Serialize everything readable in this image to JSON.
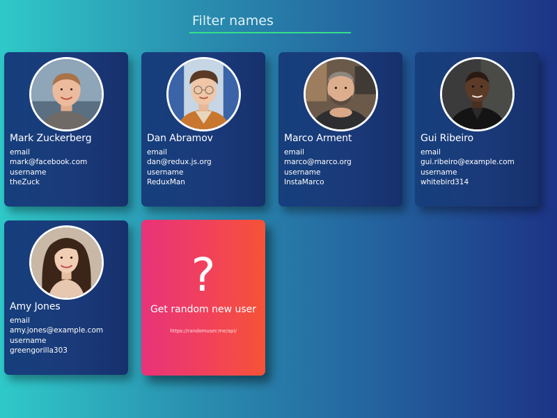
{
  "filter": {
    "placeholder": "Filter names",
    "value": ""
  },
  "field_labels": {
    "email": "email",
    "username": "username"
  },
  "users": [
    {
      "name": "Mark Zuckerberg",
      "email": "mark@facebook.com",
      "username": "theZuck"
    },
    {
      "name": "Dan Abramov",
      "email": "dan@redux.js.org",
      "username": "ReduxMan"
    },
    {
      "name": "Marco Arment",
      "email": "marco@marco.org",
      "username": "InstaMarco"
    },
    {
      "name": "Gui Ribeiro",
      "email": "gui.ribeiro@example.com",
      "username": "whitebird314"
    },
    {
      "name": "Amy Jones",
      "email": "amy.jones@example.com",
      "username": "greengorilla303"
    }
  ],
  "random_card": {
    "icon": "?",
    "title": "Get random new user",
    "url": "https://randomuser.me/api/"
  },
  "colors": {
    "filter_underline": "#36e08a",
    "card_bg": "#1b3a7a",
    "random_card_left": "#e8337a",
    "random_card_right": "#f65336"
  }
}
